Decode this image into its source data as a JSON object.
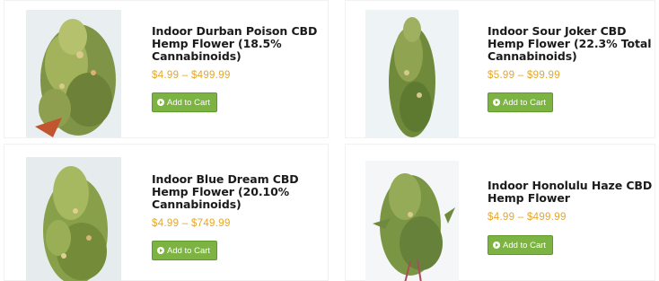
{
  "products": [
    {
      "title": "Indoor Durban Poison CBD Hemp Flower (18.5% Cannabinoids)",
      "price": "$4.99 – $499.99",
      "button_label": "Add to Cart",
      "image": "hemp-flower-bud-image"
    },
    {
      "title": "Indoor Sour Joker CBD Hemp Flower (22.3% Total Cannabinoids)",
      "price": "$5.99 – $99.99",
      "button_label": "Add to Cart",
      "image": "hemp-flower-bud-image"
    },
    {
      "title": "Indoor Blue Dream CBD Hemp Flower (20.10% Cannabinoids)",
      "price": "$4.99 – $749.99",
      "button_label": "Add to Cart",
      "image": "hemp-flower-bud-image"
    },
    {
      "title": "Indoor Honolulu Haze CBD Hemp Flower",
      "price": "$4.99 – $499.99",
      "button_label": "Add to Cart",
      "image": "hemp-flower-bud-image"
    }
  ],
  "colors": {
    "price": "#e6a62a",
    "button": "#7cb342",
    "title": "#1b1b1b"
  }
}
